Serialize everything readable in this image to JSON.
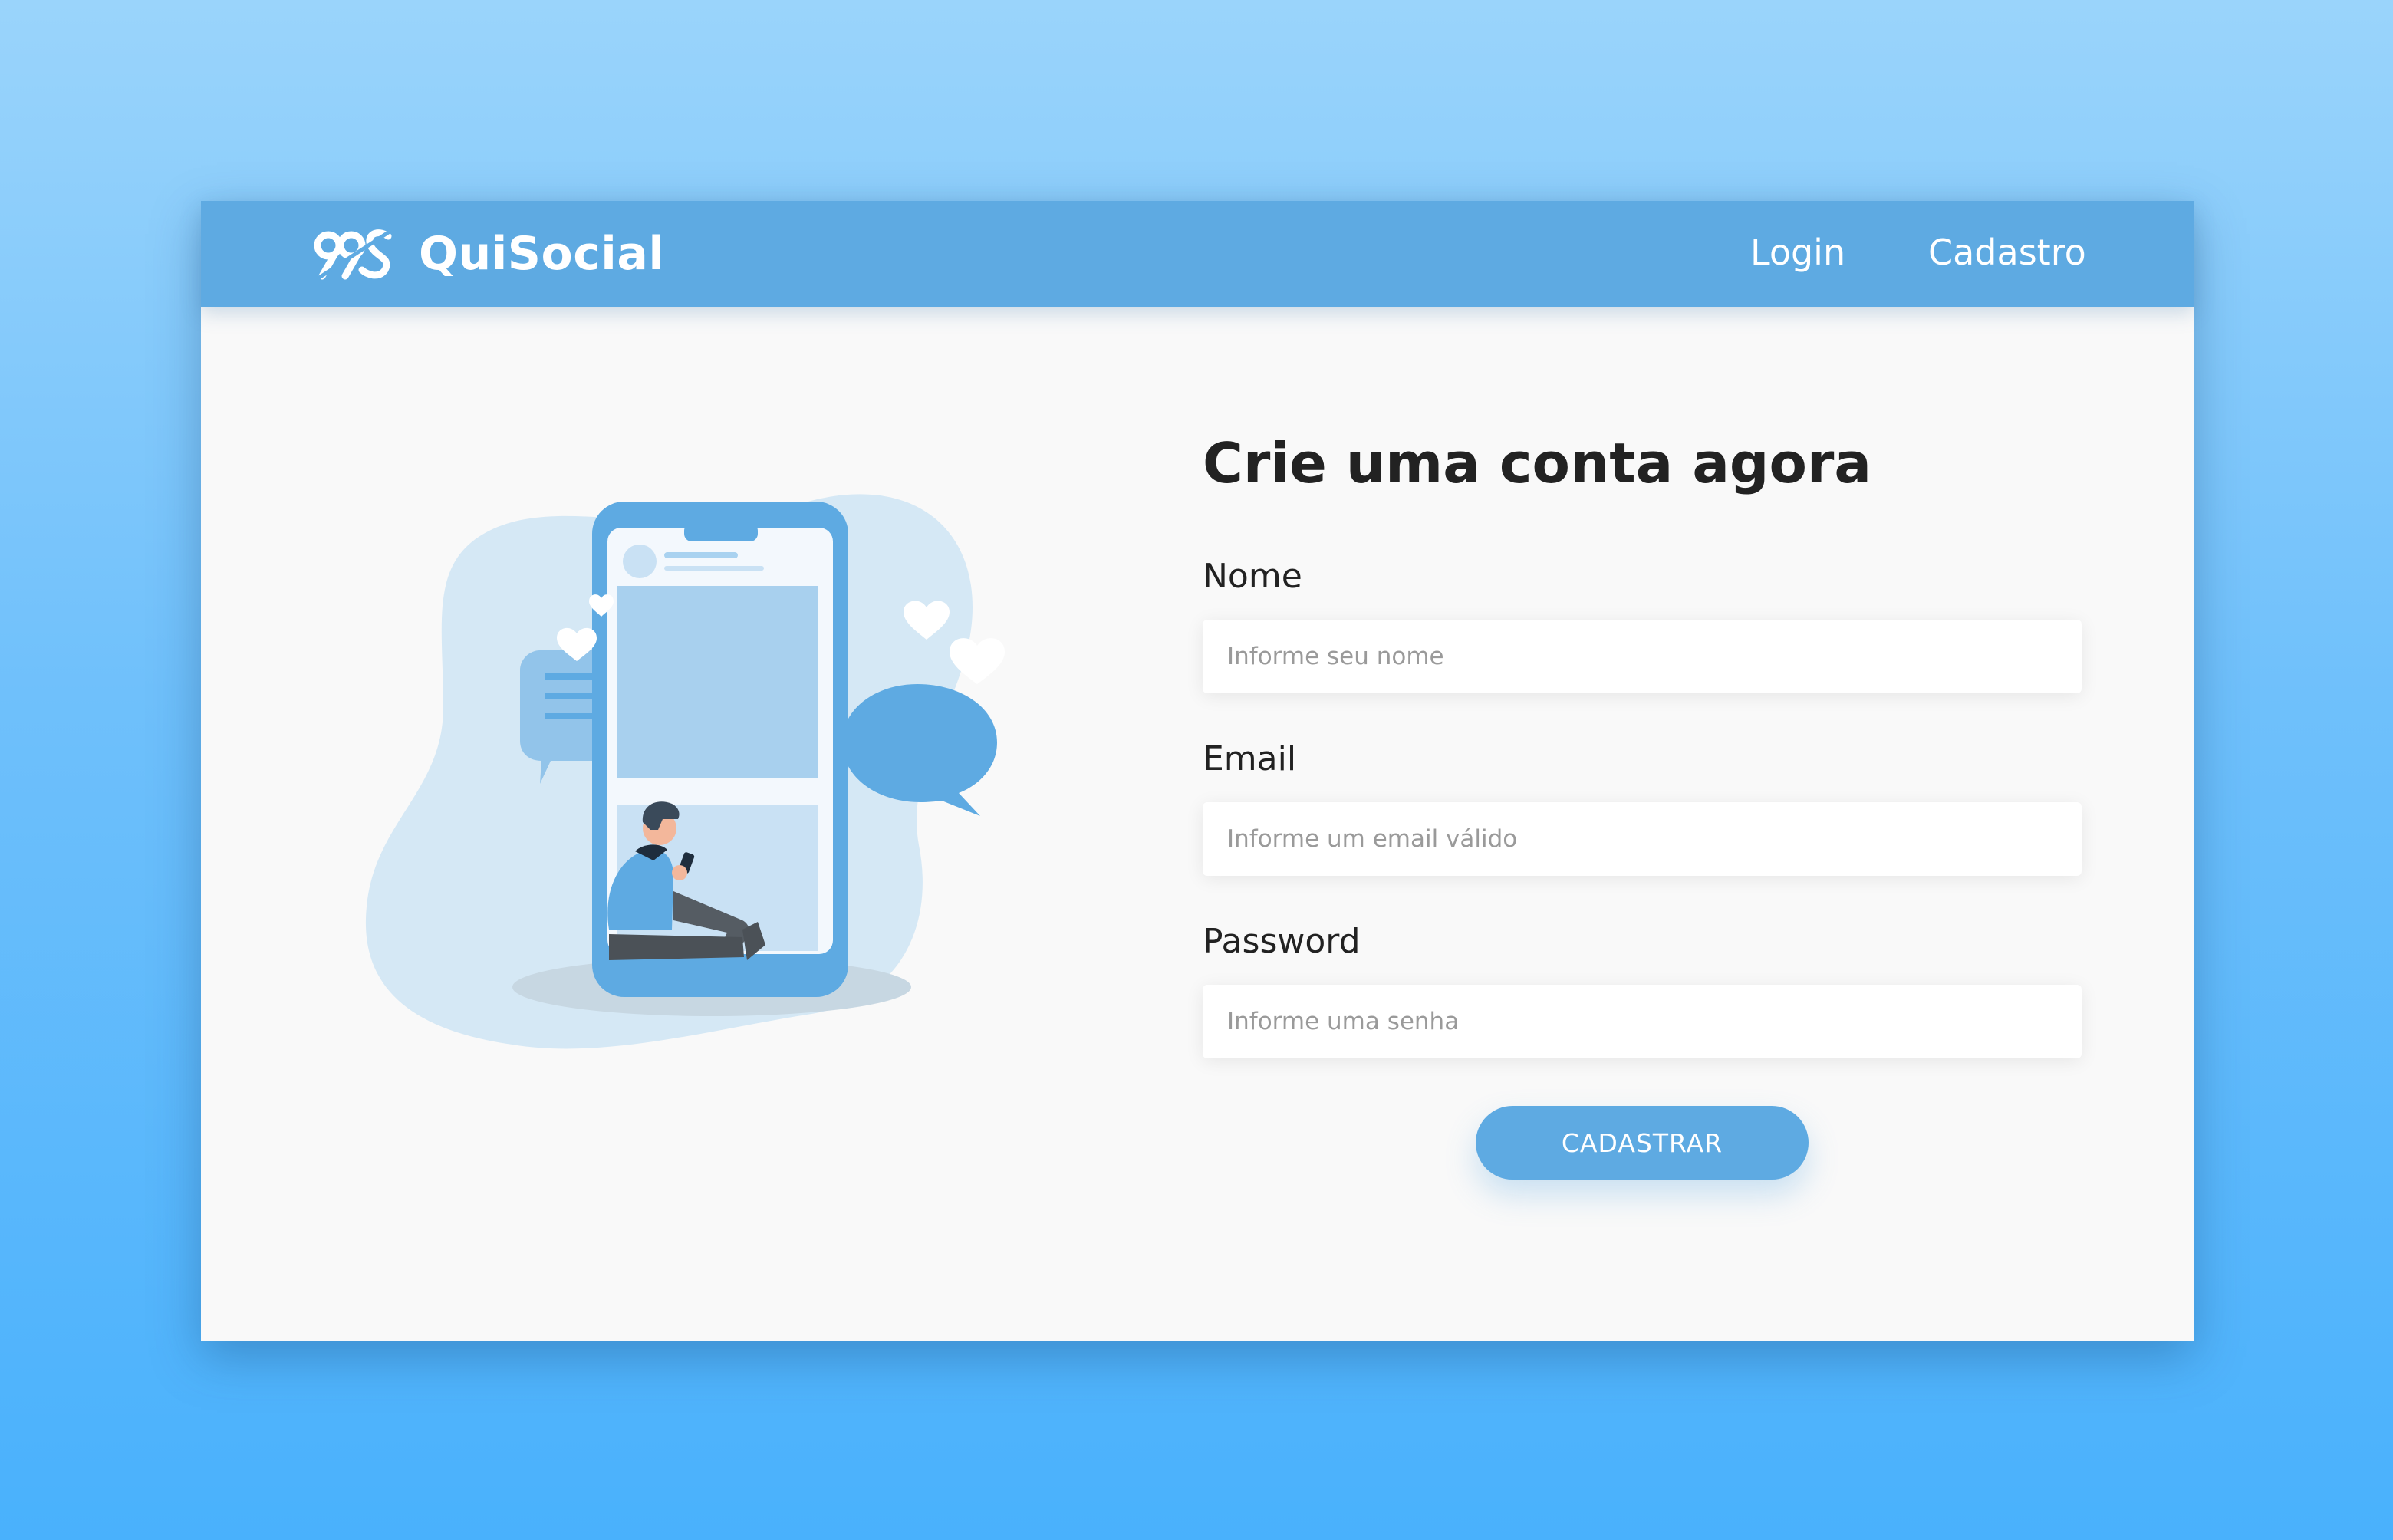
{
  "navbar": {
    "brand": "QuiSocial",
    "links": [
      {
        "label": "Login"
      },
      {
        "label": "Cadastro"
      }
    ]
  },
  "form": {
    "title": "Crie uma conta agora",
    "fields": [
      {
        "label": "Nome",
        "placeholder": "Informe seu nome",
        "value": ""
      },
      {
        "label": "Email",
        "placeholder": "Informe um email válido",
        "value": ""
      },
      {
        "label": "Password",
        "placeholder": "Informe uma senha",
        "value": ""
      }
    ],
    "submit_label": "CADASTRAR"
  },
  "colors": {
    "brand": "#5eaae2",
    "page_background_top": "#9ad4fb",
    "page_background_bottom": "#49b1fc",
    "card_background": "#f9f9f9",
    "text_dark": "#222222"
  },
  "icons": {
    "logo": "quisocial-logo-icon",
    "illustration": "phone-social-illustration"
  }
}
